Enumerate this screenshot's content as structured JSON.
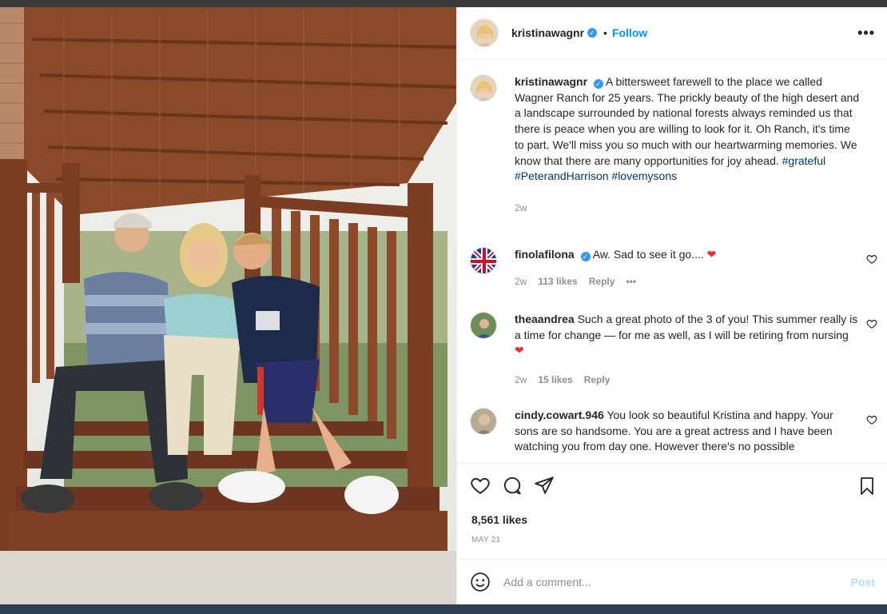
{
  "post": {
    "username": "kristinawagnr",
    "follow_label": "Follow",
    "more_label": "•••",
    "separator": "•",
    "caption": {
      "username": "kristinawagnr",
      "text": "A bittersweet farewell to the place we called Wagner Ranch for 25 years. The prickly beauty of the high desert and a landscape surrounded by national forests always reminded us that there is peace when you are willing to look for it. Oh Ranch, it's time to part. We'll miss you so much with our heartwarming memories. We know that there are many opportunities for joy ahead.",
      "hashtags": [
        "#grateful",
        "#PeterandHarrison",
        "#lovemysons"
      ],
      "time": "2w"
    },
    "comments": [
      {
        "username": "finolafilona",
        "text": "Aw. Sad to see it go....",
        "emoji": "❤",
        "time": "2w",
        "likes": "113 likes",
        "reply": "Reply",
        "more": "•••"
      },
      {
        "username": "theaandrea",
        "text": "Such a great photo of the 3 of you! This summer really is a time for change — for me as well, as I will be retiring from nursing",
        "emoji": "❤",
        "time": "2w",
        "likes": "15 likes",
        "reply": "Reply"
      },
      {
        "username": "cindy.cowart.946",
        "text": "You look so beautiful Kristina and happy. Your sons are so handsome. You are a great actress and I have been watching you from day one. However there's no possible"
      }
    ],
    "likes_count": "8,561 likes",
    "date": "MAY 21",
    "comment_placeholder": "Add a comment...",
    "post_label": "Post"
  },
  "icons": {
    "verified": "verified-badge-icon",
    "like": "heart-icon",
    "comment": "comment-icon",
    "share": "paper-plane-icon",
    "save": "bookmark-icon",
    "emoji": "smiley-icon"
  },
  "colors": {
    "link": "#0095f6",
    "hashtag": "#00376b",
    "muted": "#8e8e8e",
    "heart": "#ed2e3a"
  }
}
